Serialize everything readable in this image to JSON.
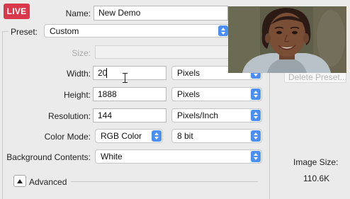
{
  "badge": {
    "live": "LIVE"
  },
  "form": {
    "name_label": "Name:",
    "name_value": "New Demo",
    "preset_label": "Preset:",
    "preset_value": "Custom",
    "size_label": "Size:",
    "size_value": "",
    "width_label": "Width:",
    "width_value": "20",
    "width_unit": "Pixels",
    "height_label": "Height:",
    "height_value": "1888",
    "height_unit": "Pixels",
    "resolution_label": "Resolution:",
    "resolution_value": "144",
    "resolution_unit": "Pixels/Inch",
    "color_mode_label": "Color Mode:",
    "color_mode_value": "RGB Color",
    "bit_depth_value": "8 bit",
    "background_label": "Background Contents:",
    "background_value": "White",
    "advanced_label": "Advanced"
  },
  "side": {
    "delete_preset_label": "Delete Preset...",
    "image_size_label": "Image Size:",
    "image_size_value": "110.6K"
  },
  "colors": {
    "live_badge": "#d9394a",
    "stepper_accent": "#4a8ef6",
    "window_bg": "#ebebeb"
  },
  "icons": {
    "stepper": "up-down-arrows-icon",
    "text_cursor": "ibeam-cursor-icon",
    "advanced_toggle": "disclosure-triangle-icon"
  }
}
